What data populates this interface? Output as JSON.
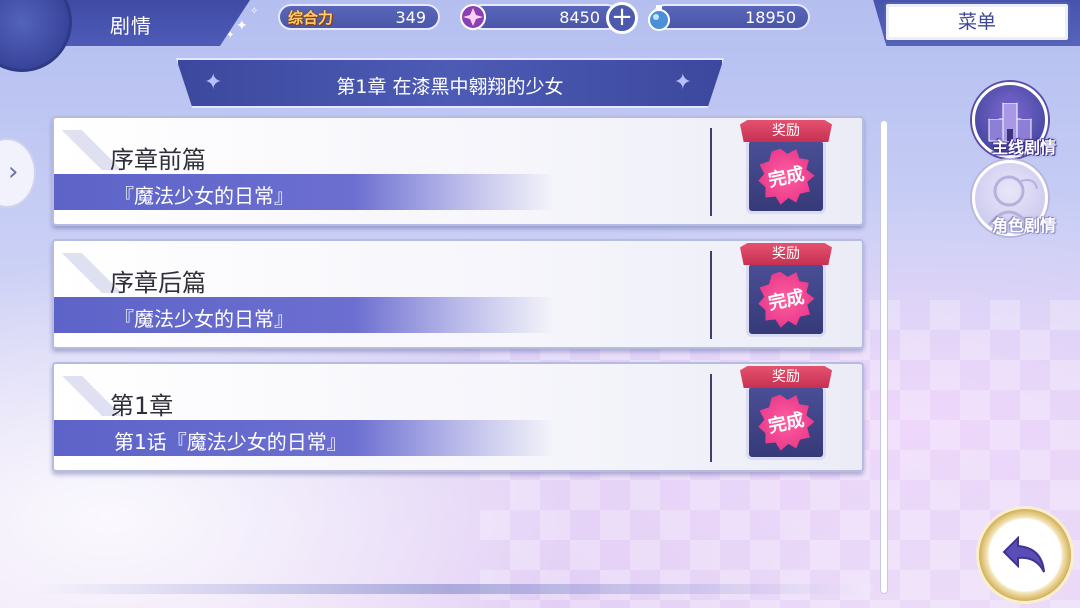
{
  "header": {
    "title": "剧情",
    "power_label": "综合力",
    "power_value": "349",
    "gem_value": "8450",
    "potion_value": "18950",
    "plus_label": "+",
    "menu_label": "菜单"
  },
  "chapter": {
    "title": "第1章 在漆黑中翱翔的少女"
  },
  "stories": [
    {
      "title": "序章前篇",
      "subtitle": "『魔法少女的日常』",
      "reward_label": "奖励",
      "status": "完成"
    },
    {
      "title": "序章后篇",
      "subtitle": "『魔法少女的日常』",
      "reward_label": "奖励",
      "status": "完成"
    },
    {
      "title": "第1章",
      "subtitle": "第1话『魔法少女的日常』",
      "reward_label": "奖励",
      "status": "完成"
    }
  ],
  "side_tabs": {
    "main_story": "主线剧情",
    "character_story": "角色剧情"
  },
  "icons": {
    "left_nav": "chevron-left-icon",
    "gem": "gem-icon",
    "potion": "potion-icon",
    "back": "back-arrow-icon",
    "castle": "castle-icon",
    "character": "character-silhouette-icon"
  },
  "colors": {
    "accent": "#4d59ab",
    "reward_ribbon": "#d63a5c",
    "complete_stamp": "#e8378a",
    "subtitle_bar": "#5d63c8"
  }
}
